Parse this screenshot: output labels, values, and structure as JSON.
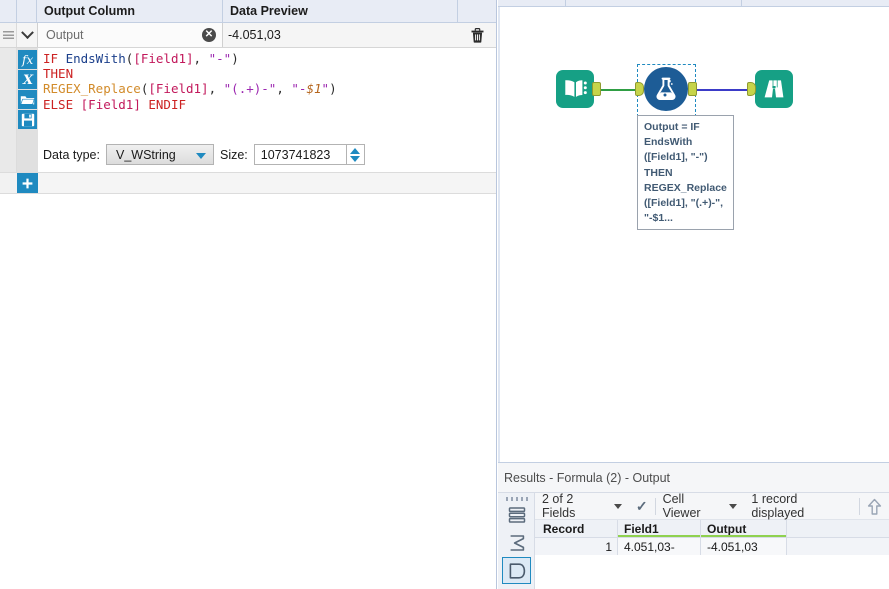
{
  "config_panel": {
    "columns": {
      "output_column": "Output Column",
      "data_preview": "Data Preview"
    },
    "output_name": {
      "value": "Output",
      "placeholder": "Output",
      "clear_icon": "clear-circle-icon"
    },
    "data_preview_value": "-4.051,03",
    "delete_icon": "trash-icon",
    "drag_handle_icon": "drag-grip-icon",
    "collapse_icon": "chevron-down-icon",
    "rail_buttons": [
      {
        "name": "function-fx-icon",
        "label": "fx"
      },
      {
        "name": "variable-x-icon",
        "label": "X"
      },
      {
        "name": "folder-open-icon",
        "label": "open"
      },
      {
        "name": "save-disk-icon",
        "label": "save"
      }
    ],
    "formula_lines": [
      [
        {
          "t": "IF ",
          "c": "kw"
        },
        {
          "t": "EndsWith",
          "c": "fn"
        },
        {
          "t": "(",
          "c": "pun"
        },
        {
          "t": "[Field1]",
          "c": "fld"
        },
        {
          "t": ", ",
          "c": "pun"
        },
        {
          "t": "\"-\"",
          "c": "str"
        },
        {
          "t": ")",
          "c": "pun"
        }
      ],
      [
        {
          "t": "THEN",
          "c": "kw"
        }
      ],
      [
        {
          "t": "REGEX_Replace",
          "c": "fn2"
        },
        {
          "t": "(",
          "c": "pun"
        },
        {
          "t": "[Field1]",
          "c": "fld"
        },
        {
          "t": ", ",
          "c": "pun"
        },
        {
          "t": "\"(.+)-\"",
          "c": "str"
        },
        {
          "t": ", ",
          "c": "pun"
        },
        {
          "t": "\"-",
          "c": "str"
        },
        {
          "t": "$1",
          "c": "var"
        },
        {
          "t": "\"",
          "c": "str"
        },
        {
          "t": ")",
          "c": "pun"
        }
      ],
      [
        {
          "t": "ELSE ",
          "c": "kw"
        },
        {
          "t": "[Field1]",
          "c": "fld"
        },
        {
          "t": " ENDIF",
          "c": "kw"
        }
      ]
    ],
    "data_type_label": "Data type:",
    "data_type_value": "V_WString",
    "size_label": "Size:",
    "size_value": "1073741823",
    "add_button_label": "+"
  },
  "canvas": {
    "tools": [
      {
        "name": "input-data-tool",
        "icon": "book-icon",
        "color": "#16a085"
      },
      {
        "name": "formula-tool",
        "icon": "flask-icon",
        "color": "#1d5c96",
        "selected": true
      },
      {
        "name": "browse-tool",
        "icon": "binoculars-icon",
        "color": "#16a085"
      }
    ],
    "annotation": "Output = IF\nEndsWith\n([Field1], \"-\")\nTHEN\nREGEX_Replace\n([Field1], \"(.+)-\",\n\"-$1..."
  },
  "results": {
    "title": "Results - Formula (2) - Output",
    "rail_icons": [
      {
        "name": "records-table-icon"
      },
      {
        "name": "sigma-summary-icon"
      },
      {
        "name": "data-profile-icon",
        "active": true
      }
    ],
    "toolbar": {
      "fields_label": "2 of 2 Fields",
      "check_icon": "checkmark-icon",
      "cell_viewer_label": "Cell Viewer",
      "records_label": "1 record displayed",
      "expand_icon": "arrow-up-icon"
    },
    "grid": {
      "headers": [
        "Record",
        "Field1",
        "Output"
      ],
      "rows": [
        {
          "record": "1",
          "field1": "4.051,03-",
          "output": "-4.051,03"
        }
      ]
    }
  },
  "colors": {
    "accent_blue": "#1f8ac0",
    "tool_teal": "#16a085",
    "tool_navy": "#1d5c96",
    "anchor_green": "#c6d44a",
    "wire_green": "#2f9e44",
    "wire_blue": "#3b3bc8",
    "header_green": "#8fd14f"
  }
}
